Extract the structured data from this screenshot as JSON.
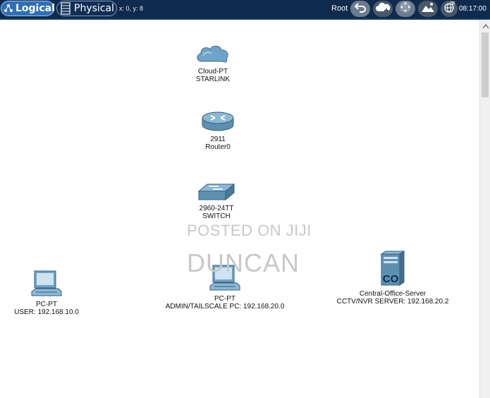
{
  "toolbar": {
    "tabs": {
      "logical": "Logical",
      "physical": "Physical"
    },
    "coords": "x: 0, y: 8",
    "root": "Root",
    "clock": "08:17:00",
    "colors": {
      "bar": "#0e2a4d",
      "active_tab": "#2f6fb6"
    }
  },
  "devices": {
    "cloud": {
      "model": "Cloud-PT",
      "name": "STARLINK",
      "icon": "cloud-icon"
    },
    "router": {
      "model": "2911",
      "name": "Router0",
      "icon": "router-icon"
    },
    "switch": {
      "model": "2960-24TT",
      "name": "SWITCH",
      "icon": "switch-icon"
    },
    "pc_user": {
      "model": "PC-PT",
      "name": "USER: 192.168.10.0",
      "icon": "pc-icon"
    },
    "pc_admin": {
      "model": "PC-PT",
      "name": "ADMIN/TAILSCALE PC: 192.168.20.0",
      "icon": "pc-icon"
    },
    "server": {
      "model": "Central-Office-Server",
      "name": "CCTV/NVR SERVER: 192.168.20.2",
      "icon": "server-icon"
    }
  },
  "watermark": {
    "line1": "POSTED ON JIJI",
    "line2": "DUNCAN"
  }
}
